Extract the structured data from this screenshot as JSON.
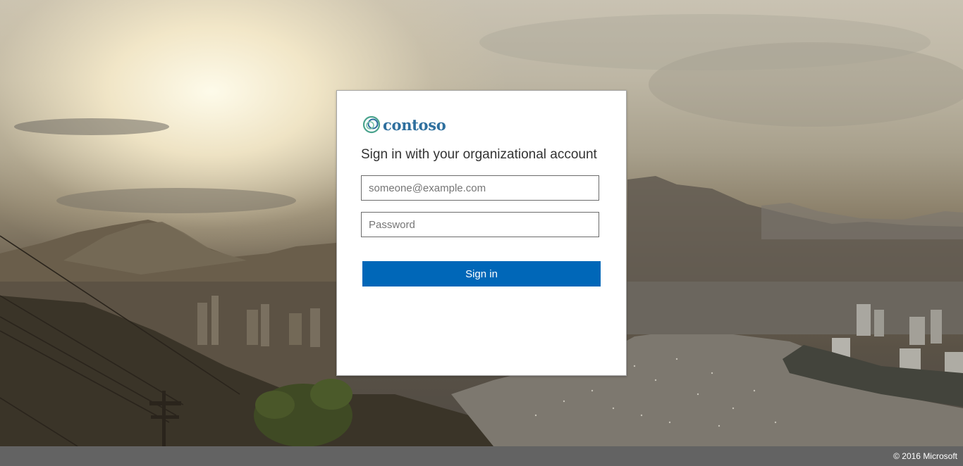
{
  "brand": {
    "name": "contoso",
    "logo_icon": "contoso-ring-logo",
    "color": "#2e6f9e"
  },
  "signin": {
    "heading": "Sign in with your organizational account",
    "username_placeholder": "someone@example.com",
    "username_value": "",
    "password_placeholder": "Password",
    "password_value": "",
    "submit_label": "Sign in",
    "submit_color": "#0067b8"
  },
  "footer": {
    "copyright": "© 2016 Microsoft",
    "background": "#636363"
  },
  "background": {
    "description_icon": "sunset-bay-illustration"
  }
}
